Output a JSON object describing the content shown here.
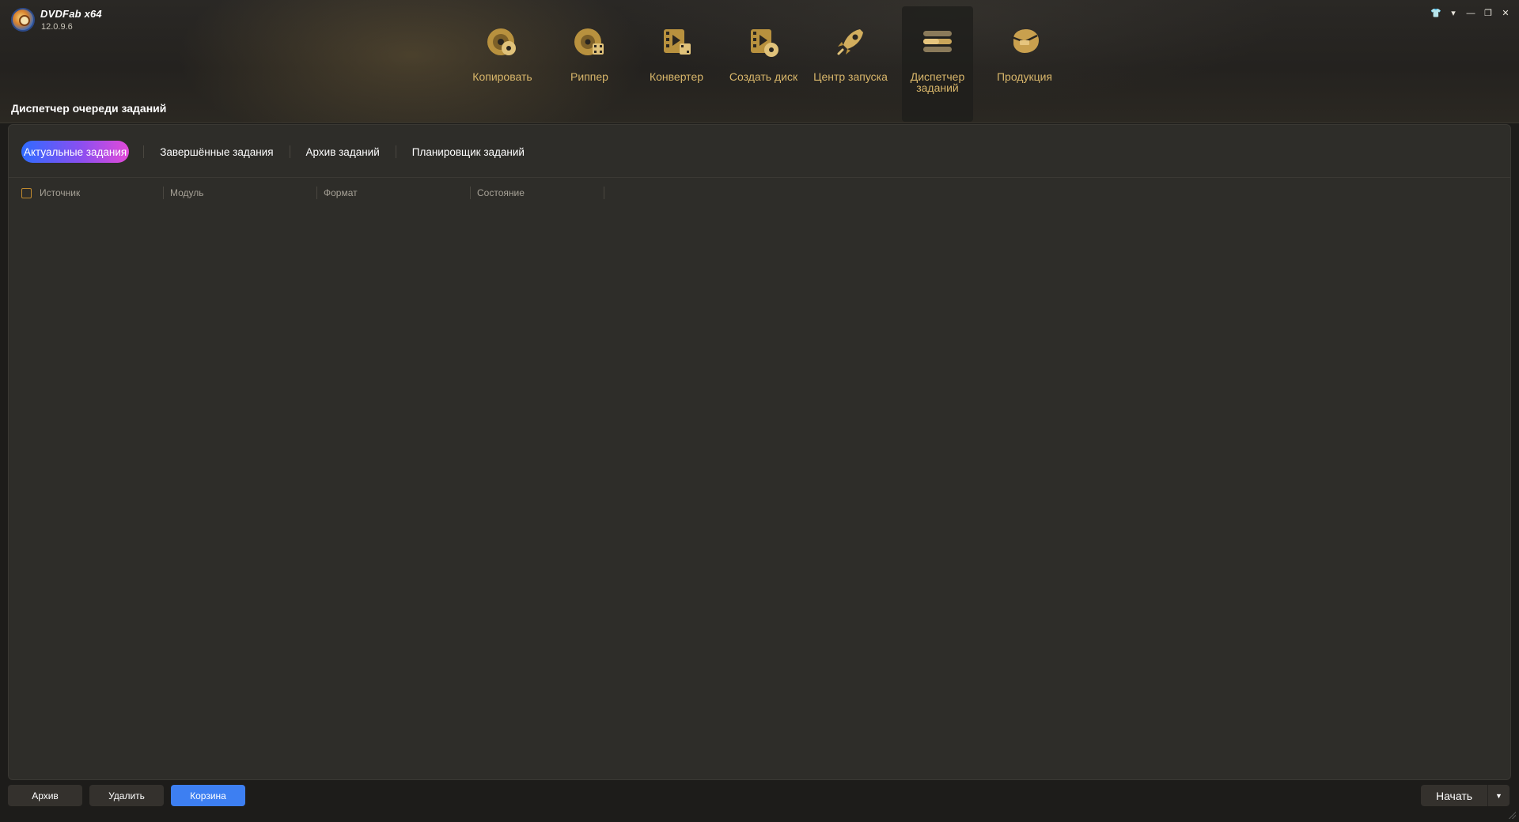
{
  "app": {
    "name": "DVDFab x64",
    "version": "12.0.9.6"
  },
  "window_controls": [
    {
      "name": "skin-icon",
      "glyph": "👕"
    },
    {
      "name": "menu-icon",
      "glyph": "▾"
    },
    {
      "name": "minimize-icon",
      "glyph": "—"
    },
    {
      "name": "restore-icon",
      "glyph": "❐"
    },
    {
      "name": "close-icon",
      "glyph": "✕"
    }
  ],
  "nav": {
    "items": [
      {
        "label": "Копировать",
        "icon": "copy-disc-icon"
      },
      {
        "label": "Риппер",
        "icon": "ripper-icon"
      },
      {
        "label": "Конвертер",
        "icon": "converter-icon"
      },
      {
        "label": "Создать диск",
        "icon": "creator-icon"
      },
      {
        "label": "Центр запуска",
        "icon": "launchpad-icon"
      },
      {
        "label": "Диспетчер заданий",
        "icon": "task-queue-icon",
        "active": true
      },
      {
        "label": "Продукция",
        "icon": "products-icon"
      }
    ]
  },
  "page": {
    "title": "Диспетчер очереди заданий"
  },
  "tabs": [
    {
      "label": "Актуальные задания",
      "active": true
    },
    {
      "label": "Завершённые задания"
    },
    {
      "label": "Архив заданий"
    },
    {
      "label": "Планировщик заданий"
    }
  ],
  "table": {
    "columns": [
      "Источник",
      "Модуль",
      "Формат",
      "Состояние"
    ],
    "rows": []
  },
  "footer": {
    "archive_label": "Архив",
    "delete_label": "Удалить",
    "trash_label": "Корзина",
    "start_label": "Начать"
  },
  "colors": {
    "accent_gold": "#d8b66a",
    "primary_blue": "#3d7ff2",
    "tab_gradient": [
      "#2f6bff",
      "#8a4ff0",
      "#e24ad8"
    ]
  }
}
